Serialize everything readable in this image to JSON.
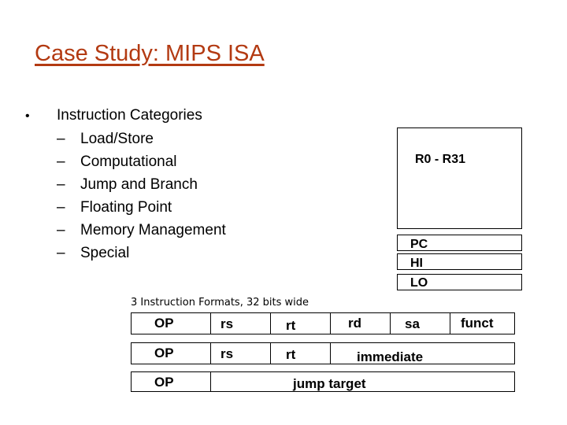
{
  "slide": {
    "title": "Case Study: MIPS ISA",
    "bullets": [
      {
        "label": "Instruction Categories",
        "sub_items": [
          "Load/Store",
          "Computational",
          "Jump and Branch",
          "Floating Point",
          "Memory Management",
          "Special"
        ]
      }
    ],
    "bullet_glyph": "•",
    "sub_glyph": "–"
  },
  "registers": {
    "file_label": "R0 - R31",
    "special": [
      "PC",
      "HI",
      "LO"
    ]
  },
  "formats": {
    "caption": "3 Instruction Formats, 32 bits wide",
    "rows": [
      {
        "type": "R",
        "fields": [
          "OP",
          "rs",
          "rt",
          "rd",
          "sa",
          "funct"
        ]
      },
      {
        "type": "I",
        "fields": [
          "OP",
          "rs",
          "rt",
          "immediate"
        ]
      },
      {
        "type": "J",
        "fields": [
          "OP",
          "jump target"
        ]
      }
    ]
  },
  "colors": {
    "title": "#b33a12",
    "text": "#000000",
    "background": "#ffffff"
  }
}
